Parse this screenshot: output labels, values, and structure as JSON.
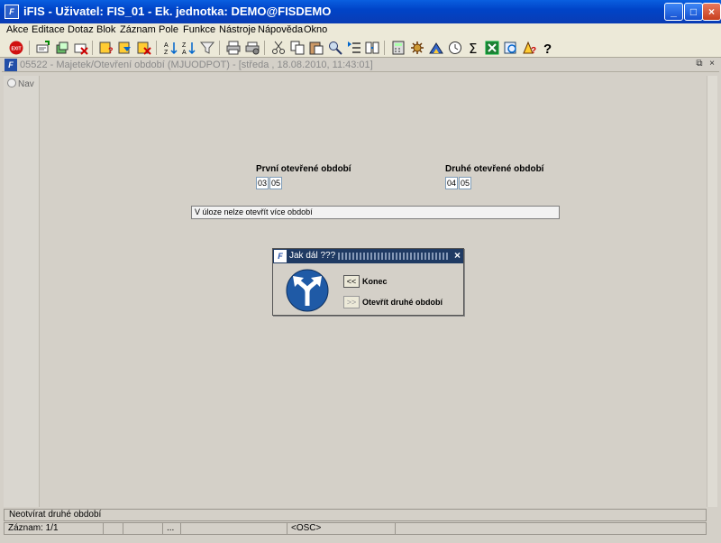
{
  "window": {
    "title": "iFIS - Uživatel: FIS_01 - Ek. jednotka: DEMO@FISDEMO",
    "app_icon_text": "F"
  },
  "menu": [
    "Akce",
    "Editace",
    "Dotaz",
    "Blok",
    "Záznam",
    "Pole",
    "Funkce",
    "Nástroje",
    "Nápověda",
    "Okno"
  ],
  "inner_window": {
    "title": "05522 - Majetek/Otevření období (MJUODPOT) - [středa , 18.08.2010, 11:43:01]",
    "icon_text": "F"
  },
  "nav_label": "Nav",
  "form": {
    "first_label": "První otevřené období",
    "first_values": [
      "03",
      "05"
    ],
    "second_label": "Druhé otevřené období",
    "second_values": [
      "04",
      "05"
    ],
    "message": "V úloze nelze otevřít více období"
  },
  "dialog": {
    "title": "Jak dál ???",
    "close": "×",
    "options": [
      {
        "button": "<<",
        "label": "Konec",
        "enabled": true
      },
      {
        "button": ">>",
        "label": "Otevřít druhé období",
        "enabled": false
      }
    ],
    "sign_color": "#1f5aa6"
  },
  "status": {
    "hint": "Neotvírat druhé období",
    "record": "Záznam: 1/1",
    "ellipsis": "...",
    "mode": "<OSC>"
  },
  "colors": {
    "titlebar": "#0a5fe0",
    "toolbar": "#ece9d8",
    "background": "#d4d0c8"
  }
}
